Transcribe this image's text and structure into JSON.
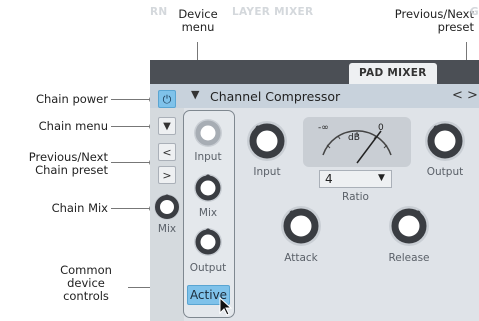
{
  "annotations": {
    "device_menu": "Device\nmenu",
    "prev_next_preset": "Previous/Next\npreset",
    "chain_power": "Chain power",
    "chain_menu": "Chain menu",
    "prev_next_chain_preset": "Previous/Next\nChain preset",
    "chain_mix": "Chain Mix",
    "common_device_controls": "Common\ndevice\ncontrols"
  },
  "tabs": {
    "partial_left": "RN",
    "layer_mixer": "LAYER MIXER",
    "pad_mixer": "PAD MIXER",
    "partial_right": "G"
  },
  "device": {
    "menu_glyph": "▼",
    "name": "Channel Compressor",
    "prev": "<",
    "next": ">"
  },
  "chain": {
    "power_glyph": "⏻",
    "menu_glyph": "▼",
    "prev": "<",
    "next": ">",
    "mix_label": "Mix"
  },
  "common_controls": {
    "input_label": "Input",
    "mix_label": "Mix",
    "output_label": "Output",
    "active_label": "Active"
  },
  "compressor": {
    "input_label": "Input",
    "output_label": "Output",
    "meter_unit": "dB",
    "meter_min": "-∞",
    "meter_max": "0",
    "ratio_value": "4",
    "ratio_label": "Ratio",
    "attack_label": "Attack",
    "release_label": "Release"
  }
}
